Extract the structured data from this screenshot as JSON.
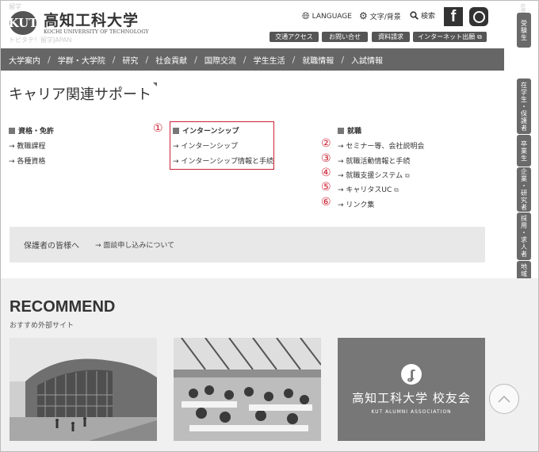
{
  "header": {
    "logo_mark": "KUT",
    "title": "高知工科大学",
    "subtitle": "KOCHI UNIVERSITY OF TECHNOLOGY",
    "ghost_top": "留学",
    "ghost_bottom": "トピタテ！留学JAPAN",
    "language": "LANGUAGE",
    "text_bg": "文字/背景",
    "search": "検索",
    "facebook": "f",
    "buttons": [
      "交通アクセス",
      "お問い合せ",
      "資料請求",
      "インターネット出願"
    ]
  },
  "nav": [
    "大学案内",
    "学群・大学院",
    "研究",
    "社会貢献",
    "国際交流",
    "学生生活",
    "就職情報",
    "入試情報"
  ],
  "side_tabs": [
    "受験生",
    "在学生・保護者",
    "卒業生",
    "企業・研究者",
    "採用・求人者",
    "地域・一般"
  ],
  "side_tabs_top": "在学生",
  "page_title": "キャリア関連サポート",
  "sections": {
    "col1": {
      "title": "資格・免許",
      "links": [
        "教職課程",
        "各種資格"
      ]
    },
    "col2": {
      "title": "インターンシップ",
      "marker": "①",
      "links": [
        "インターンシップ",
        "インターンシップ情報と手続"
      ]
    },
    "col3": {
      "title": "就職",
      "links": [
        {
          "num": "②",
          "label": "セミナー等、会社説明会"
        },
        {
          "num": "③",
          "label": "就職活動情報と手続"
        },
        {
          "num": "④",
          "label": "就職支援システム"
        },
        {
          "num": "⑤",
          "label": "キャリタスUC"
        },
        {
          "num": "⑥",
          "label": "リンク集"
        }
      ]
    }
  },
  "guardian": {
    "title": "保護者の皆様へ",
    "link": "面談申し込みについて"
  },
  "recommend": {
    "title": "RECOMMEND",
    "subtitle": "おすすめ外部サイト",
    "alumni_name": "高知工科大学 校友会",
    "alumni_en": "KUT ALUMNI ASSOCIATION"
  }
}
